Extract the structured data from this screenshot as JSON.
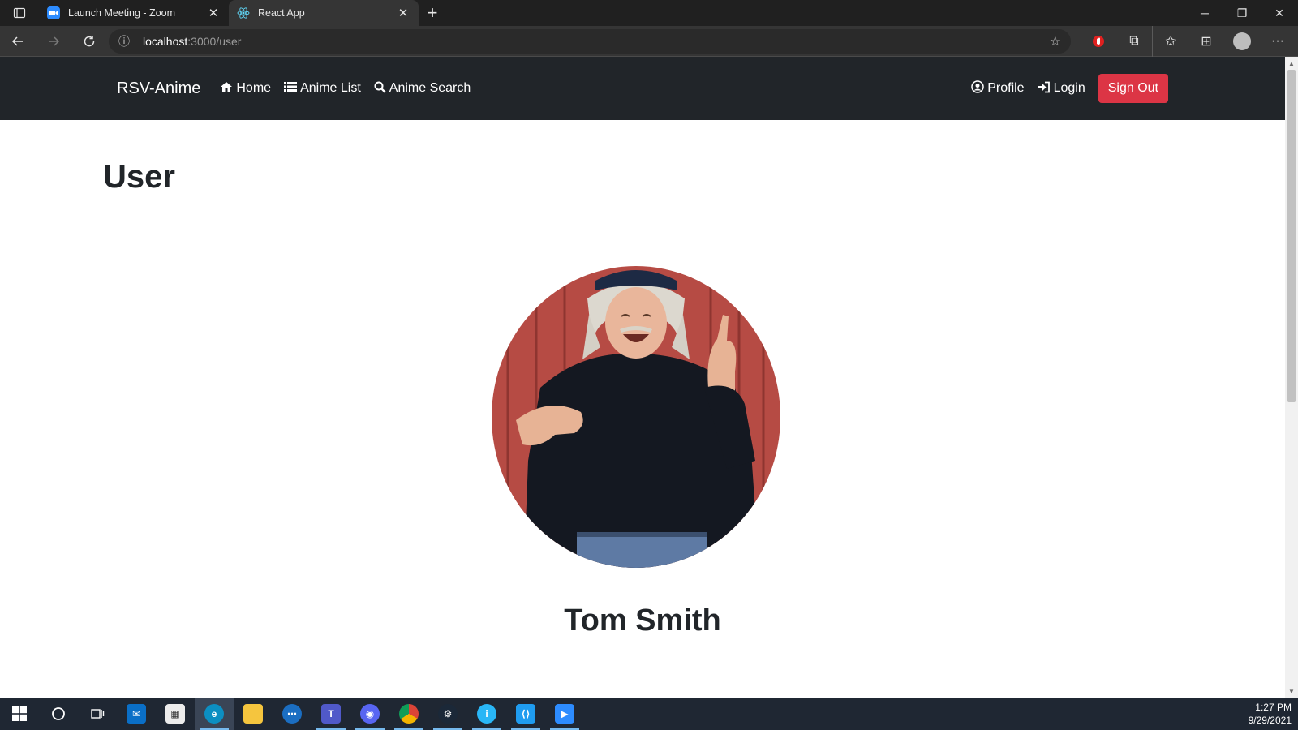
{
  "browser": {
    "tabs": [
      {
        "title": "Launch Meeting - Zoom",
        "favicon": "zoom-icon",
        "active": false
      },
      {
        "title": "React App",
        "favicon": "react-icon",
        "active": true
      }
    ],
    "url_host": "localhost",
    "url_path": ":3000/user"
  },
  "app": {
    "brand": "RSV-Anime",
    "nav_left": [
      {
        "label": "Home",
        "icon": "home-icon"
      },
      {
        "label": "Anime List",
        "icon": "list-icon"
      },
      {
        "label": "Anime Search",
        "icon": "search-icon"
      }
    ],
    "nav_right": [
      {
        "label": "Profile",
        "icon": "user-circle-icon"
      },
      {
        "label": "Login",
        "icon": "sign-in-icon"
      }
    ],
    "signout_label": "Sign Out",
    "colors": {
      "navbar": "#212529",
      "signout": "#dc3545"
    }
  },
  "page": {
    "title": "User",
    "user_name": "Tom Smith"
  },
  "taskbar": {
    "time": "1:27 PM",
    "date": "9/29/2021"
  }
}
